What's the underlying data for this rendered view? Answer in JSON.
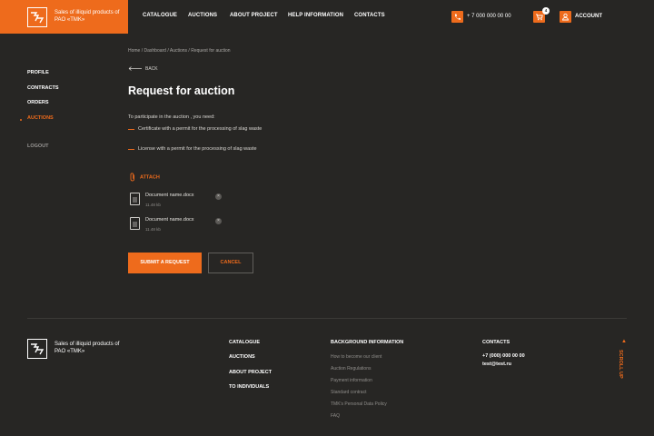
{
  "header": {
    "logo_text": "Sales of illiquid products of PAO «TMK»",
    "nav": [
      "CATALOGUE",
      "AUCTIONS",
      "ABOUT PROJECT",
      "HELP INFORMATION",
      "CONTACTS"
    ],
    "phone": "+ 7 000 000 00 00",
    "cart_count": "4",
    "account_label": "ACCOUNT"
  },
  "sidebar": {
    "items": [
      "PROFILE",
      "CONTRACTS",
      "ORDERS",
      "AUCTIONS"
    ],
    "active_index": 3,
    "logout": "LOGOUT"
  },
  "main": {
    "breadcrumbs": "Home  /  Dashboard  /  Auctions  /  Request for auction",
    "back_label": "BACK",
    "title": "Request for auction",
    "intro": "To participate in the auction , you need:",
    "requirements": [
      "Certificate with a permit for the processing of slag waste",
      "License with a permit for the processing of slag waste"
    ],
    "attach_label": "ATTACH",
    "files": [
      {
        "name": "Document name.docx",
        "size": "11.48 kb"
      },
      {
        "name": "Document name.docx",
        "size": "11.48 kb"
      }
    ],
    "submit_label": "SUBMIT A REQUEST",
    "cancel_label": "CANCEL"
  },
  "footer": {
    "logo_text": "Sales of illiquid products of PAO «TMK»",
    "col1_links": [
      "CATALOGUE",
      "AUCTIONS",
      "ABOUT PROJECT",
      "TO INDIVIDUALS"
    ],
    "col2_head": "BACKGROUND INFORMATION",
    "col2_links": [
      "How to become our client",
      "Auction Regulations",
      "Payment information",
      "Standard contract",
      "TMK's Personal Data Policy",
      "FAQ"
    ],
    "col3_head": "CONTACTS",
    "phone": "+7 (000) 000 00 00",
    "email": "test@test.ru",
    "scroll_up": "SCROLL UP"
  },
  "colors": {
    "accent": "#ee6b1c",
    "background": "#272624"
  }
}
